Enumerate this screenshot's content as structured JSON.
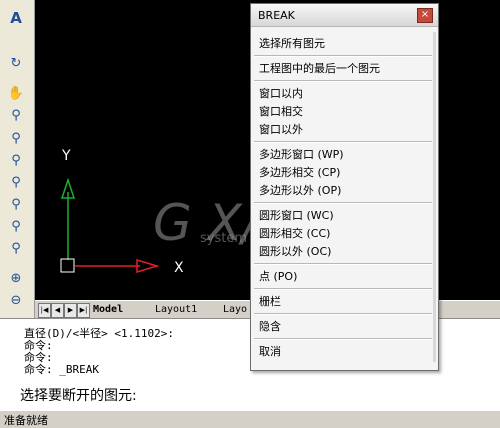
{
  "menu": {
    "title": "BREAK",
    "close_symbol": "×",
    "items": [
      "选择所有图元",
      "工程图中的最后一个图元",
      "窗口以内",
      "窗口相交",
      "窗口以外",
      "多边形窗口 (WP)",
      "多边形相交 (CP)",
      "多边形以外 (OP)",
      "圆形窗口 (WC)",
      "圆形相交 (CC)",
      "圆形以外 (OC)",
      "点 (PO)",
      "栅栏",
      "隐含",
      "取消"
    ]
  },
  "canvas": {
    "axis_y": "Y",
    "axis_x": "X",
    "axis_x_color": "#e0202a",
    "axis_y_color": "#1fae2f"
  },
  "tabs": {
    "nav": [
      "|◀",
      "◀",
      "▶",
      "▶|"
    ],
    "model": "Model",
    "layout1": "Layout1",
    "layout2": "Layo"
  },
  "command": {
    "lines": [
      "直径(D)/<半径> <1.1102>:",
      "命令:",
      "命令:",
      "命令: _BREAK"
    ],
    "prompt": "选择要断开的图元:"
  },
  "status": {
    "text": "准备就绪"
  },
  "watermark": {
    "big": "G X/",
    "small": "system"
  },
  "toolbar_icons": [
    "text-icon",
    "redo-icon",
    "pan-hand-icon",
    "zoom-realtime-icon",
    "zoom-window-icon",
    "zoom-dynamic-icon",
    "zoom-scale-icon",
    "zoom-center-icon",
    "zoom-object-icon",
    "zoom-in-icon",
    "zoom-out-icon",
    "zoom-all-icon",
    "zoom-extents-icon"
  ]
}
